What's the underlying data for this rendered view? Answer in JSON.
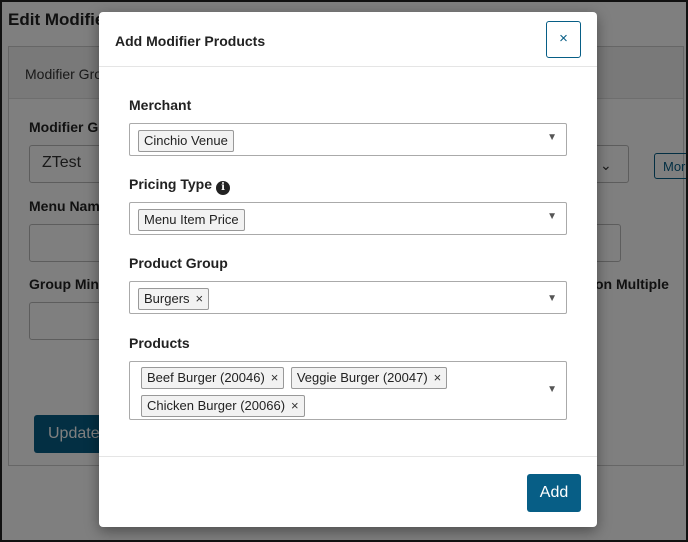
{
  "background": {
    "page_title": "Edit Modifier",
    "panel_title": "Modifier Gro",
    "modifier_group_label": "Modifier G",
    "modifier_group_value": "ZTest",
    "menu_name_label": "Menu Nam",
    "group_min_label": "Group Mini",
    "option_multiple_label": "on Multiple",
    "more_label": "Mor",
    "update_label": "Update"
  },
  "modal": {
    "title": "Add Modifier Products",
    "close_label": "×",
    "merchant": {
      "label": "Merchant",
      "selected": "Cinchio Venue"
    },
    "pricing_type": {
      "label": "Pricing Type",
      "selected": "Menu Item Price"
    },
    "product_group": {
      "label": "Product Group",
      "tags": [
        "Burgers"
      ]
    },
    "products": {
      "label": "Products",
      "tags": [
        "Beef Burger (20046)",
        "Veggie Burger (20047)",
        "Chicken Burger (20066)"
      ]
    },
    "remove_glyph": "×",
    "arrow_glyph": "▼",
    "add_label": "Add"
  },
  "colors": {
    "accent": "#075e86"
  }
}
